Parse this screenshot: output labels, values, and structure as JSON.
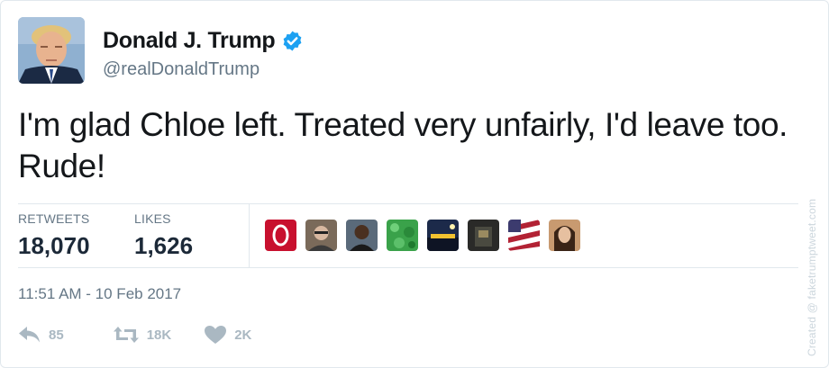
{
  "author": {
    "name": "Donald J. Trump",
    "handle": "@realDonaldTrump",
    "verified": true
  },
  "tweet": {
    "text": "I'm glad Chloe left. Treated very unfairly, I'd leave too. Rude!"
  },
  "stats": {
    "retweets_label": "RETWEETS",
    "retweets_value": "18,070",
    "likes_label": "LIKES",
    "likes_value": "1,626"
  },
  "likers": [
    {
      "icon": "avatar-red-logo",
      "color": "#c8102e"
    },
    {
      "icon": "avatar-man-glasses",
      "color": "#7a6a5a"
    },
    {
      "icon": "avatar-man-dark",
      "color": "#3a3a3a"
    },
    {
      "icon": "avatar-green-pattern",
      "color": "#3aa24a"
    },
    {
      "icon": "avatar-night-scene",
      "color": "#1c2a4a"
    },
    {
      "icon": "avatar-dark-interior",
      "color": "#2a2a28"
    },
    {
      "icon": "avatar-flag",
      "color": "#b22234"
    },
    {
      "icon": "avatar-woman",
      "color": "#8a5a40"
    }
  ],
  "timestamp": "11:51 AM - 10 Feb 2017",
  "actions": {
    "reply_count": "85",
    "retweet_count": "18K",
    "like_count": "2K"
  },
  "watermark": "Created @ faketrumptweet.com",
  "colors": {
    "verified_blue": "#1da1f2",
    "secondary_text": "#657786",
    "action_gray": "#aab8c2"
  }
}
